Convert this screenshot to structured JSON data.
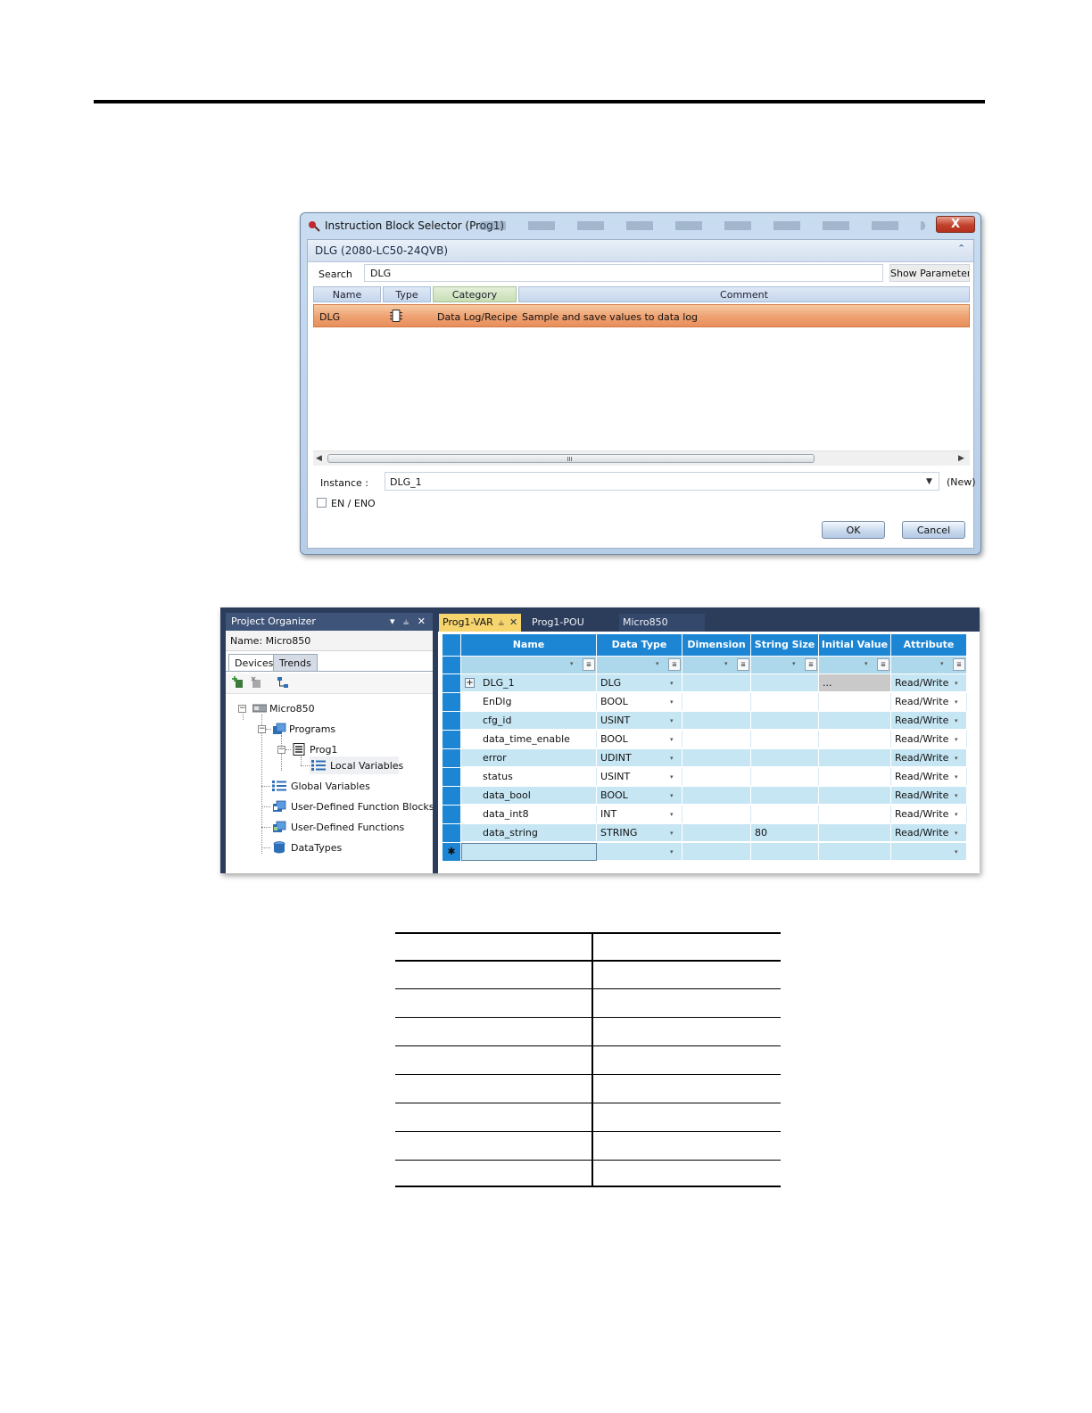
{
  "dialog": {
    "title": "Instruction Block Selector (Prog1)",
    "close_label": "X",
    "header": "DLG (2080-LC50-24QVB)",
    "collapse_icon": "double-chevron-up-icon",
    "search_label": "Search",
    "search_value": "DLG",
    "show_parameters_label": "Show Parameters",
    "columns": [
      "Name",
      "Type",
      "Category",
      "Comment"
    ],
    "result": {
      "name": "DLG",
      "type_icon": "function-block-icon",
      "category": "Data Log/Recipe",
      "comment": "Sample and save values to data log"
    },
    "instance_label": "Instance :",
    "instance_value": "DLG_1",
    "instance_status": "(New)",
    "en_eno_label": "EN / ENO",
    "en_eno_checked": false,
    "ok_label": "OK",
    "cancel_label": "Cancel"
  },
  "project_organizer": {
    "title": "Project Organizer",
    "title_buttons": "▾ ⫨ ✕",
    "name_label": "Name:",
    "name_value": "Micro850",
    "tabs": [
      "Devices",
      "Trends"
    ],
    "tree": {
      "root": "Micro850",
      "programs": "Programs",
      "prog1": "Prog1",
      "local_variables": "Local Variables",
      "global_variables": "Global Variables",
      "udfb": "User-Defined Function Blocks",
      "udf": "User-Defined Functions",
      "datatypes": "DataTypes"
    }
  },
  "editor": {
    "tabs": [
      {
        "label": "Prog1-VAR",
        "active": true
      },
      {
        "label": "Prog1-POU",
        "active": false
      },
      {
        "label": "Micro850",
        "active": false
      }
    ],
    "tab_pin_icon": "⫨",
    "tab_close_icon": "✕",
    "columns": [
      "Name",
      "Data Type",
      "Dimension",
      "String Size",
      "Initial Value",
      "Attribute"
    ],
    "rows": [
      {
        "expand": "+",
        "name": "DLG_1",
        "type": "DLG",
        "dimension": "",
        "string_size": "",
        "initial": "...",
        "attribute": "Read/Write"
      },
      {
        "expand": "",
        "name": "EnDlg",
        "type": "BOOL",
        "dimension": "",
        "string_size": "",
        "initial": "",
        "attribute": "Read/Write"
      },
      {
        "expand": "",
        "name": "cfg_id",
        "type": "USINT",
        "dimension": "",
        "string_size": "",
        "initial": "",
        "attribute": "Read/Write"
      },
      {
        "expand": "",
        "name": "data_time_enable",
        "type": "BOOL",
        "dimension": "",
        "string_size": "",
        "initial": "",
        "attribute": "Read/Write"
      },
      {
        "expand": "",
        "name": "error",
        "type": "UDINT",
        "dimension": "",
        "string_size": "",
        "initial": "",
        "attribute": "Read/Write"
      },
      {
        "expand": "",
        "name": "status",
        "type": "USINT",
        "dimension": "",
        "string_size": "",
        "initial": "",
        "attribute": "Read/Write"
      },
      {
        "expand": "",
        "name": "data_bool",
        "type": "BOOL",
        "dimension": "",
        "string_size": "",
        "initial": "",
        "attribute": "Read/Write"
      },
      {
        "expand": "",
        "name": "data_int8",
        "type": "INT",
        "dimension": "",
        "string_size": "",
        "initial": "",
        "attribute": "Read/Write"
      },
      {
        "expand": "",
        "name": "data_string",
        "type": "STRING",
        "dimension": "",
        "string_size": "80",
        "initial": "",
        "attribute": "Read/Write"
      }
    ],
    "new_row_marker": "✱",
    "dropdown_glyph": "▾",
    "filter_glyph": "≣"
  },
  "colors": {
    "grid_header": "#1d86d4",
    "grid_alt_row": "#c6e6f4",
    "result_row": "#ee9f70",
    "active_tab": "#f6d56f"
  }
}
